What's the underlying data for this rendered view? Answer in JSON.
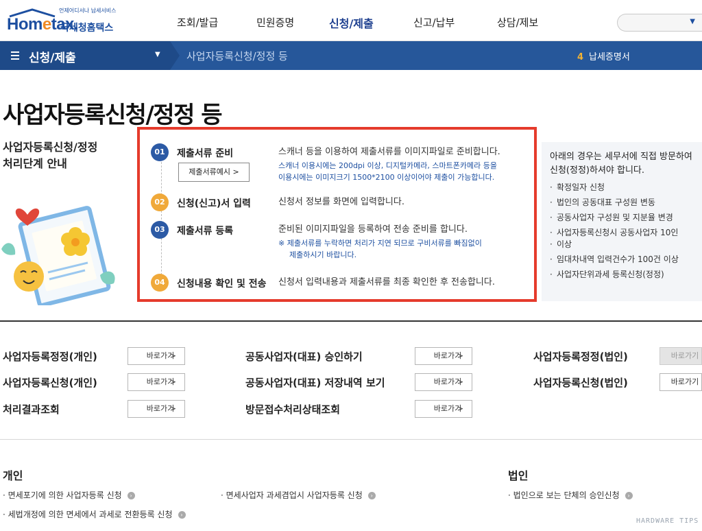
{
  "header": {
    "logo_tagline": "언제어디서나 납세서비스",
    "logo_brand_prefix": "Hom",
    "logo_brand_e": "e",
    "logo_brand_suffix": "tax.",
    "logo_org": "국세청홈택스",
    "nav": [
      {
        "label": "조회/발급",
        "active": false
      },
      {
        "label": "민원증명",
        "active": false
      },
      {
        "label": "신청/제출",
        "active": true
      },
      {
        "label": "신고/납부",
        "active": false
      },
      {
        "label": "상담/제보",
        "active": false
      }
    ],
    "search_caret": "▼"
  },
  "subbar": {
    "menu_label": "신청/제출",
    "menu_dropdown": "▼",
    "breadcrumb": "사업자등록신청/정정 등",
    "cert_number": "4",
    "cert_label": "납세증명서"
  },
  "page_title": "사업자등록신청/정정 등",
  "process_title_line1": "사업자등록신청/정정",
  "process_title_line2": "처리단계 안내",
  "steps": [
    {
      "num": "01",
      "name": "제출서류 준비",
      "desc": "스캐너 등을 이용하여 제출서류를 이미지파일로 준비합니다.",
      "note1": "스캐너 이용시에는 200dpi 이상, 디지털카메라, 스마트폰카메라 등을",
      "note2": "이용시에는 이미지크기 1500*2100 이상이어야 제출이 가능합니다.",
      "button": "제출서류예시 >"
    },
    {
      "num": "02",
      "name": "신청(신고)서 입력",
      "desc": "신청서 정보를 화면에 입력합니다."
    },
    {
      "num": "03",
      "name": "제출서류 등록",
      "desc": "준비된 이미지파일을 등록하여 전송 준비를 합니다.",
      "note1": "※ 제출서류를 누락하면 처리가 지연 되므로 구비서류를 빠짐없이",
      "note2": "제출하시기 바랍니다."
    },
    {
      "num": "04",
      "name": "신청내용 확인 및 전송",
      "desc": "신청서 입력내용과 제출서류를 최종 확인한 후 전송합니다."
    }
  ],
  "info_panel": {
    "head_line1": "아래의 경우는 세무서에 직접 방문하여",
    "head_line2": "신청(정정)하셔야 합니다.",
    "items": [
      "확정일자 신청",
      "법인의 공동대표 구성원 변동",
      "공동사업자 구성원 및 지분율 변경",
      "사업자등록신청시 공동사업자 10인",
      "이상",
      "임대차내역 입력건수가 100건 이상",
      "사업자단위과세 등록신청(정정)"
    ]
  },
  "links": {
    "go_label": "바로가기",
    "go_chevron": ">",
    "col1": [
      "사업자등록정정(개인)",
      "사업자등록신청(개인)",
      "처리결과조회"
    ],
    "col2": [
      "공동사업자(대표) 승인하기",
      "공동사업자(대표) 저장내역 보기",
      "방문접수처리상태조회"
    ],
    "col3": [
      "사업자등록정정(법인)",
      "사업자등록신청(법인)"
    ]
  },
  "sections": {
    "personal_head": "개인",
    "corporate_head": "법인",
    "personal_links": [
      "면세포기에 의한 사업자등록 신청",
      "면세사업자 과세겸업시 사업자등록 신청",
      "세법개정에 의한 면세에서 과세로 전환등록 신청"
    ],
    "corporate_links": [
      "법인으로 보는 단체의 승인신청"
    ],
    "link_icon": "›"
  },
  "watermark": "HARDWARE TIPS",
  "colors": {
    "brand_blue": "#1d4fa0",
    "subbar_blue": "#26579a",
    "highlight_red": "#e53b2c",
    "step_blue": "#2c5aa5",
    "step_orange": "#f0a93a"
  }
}
